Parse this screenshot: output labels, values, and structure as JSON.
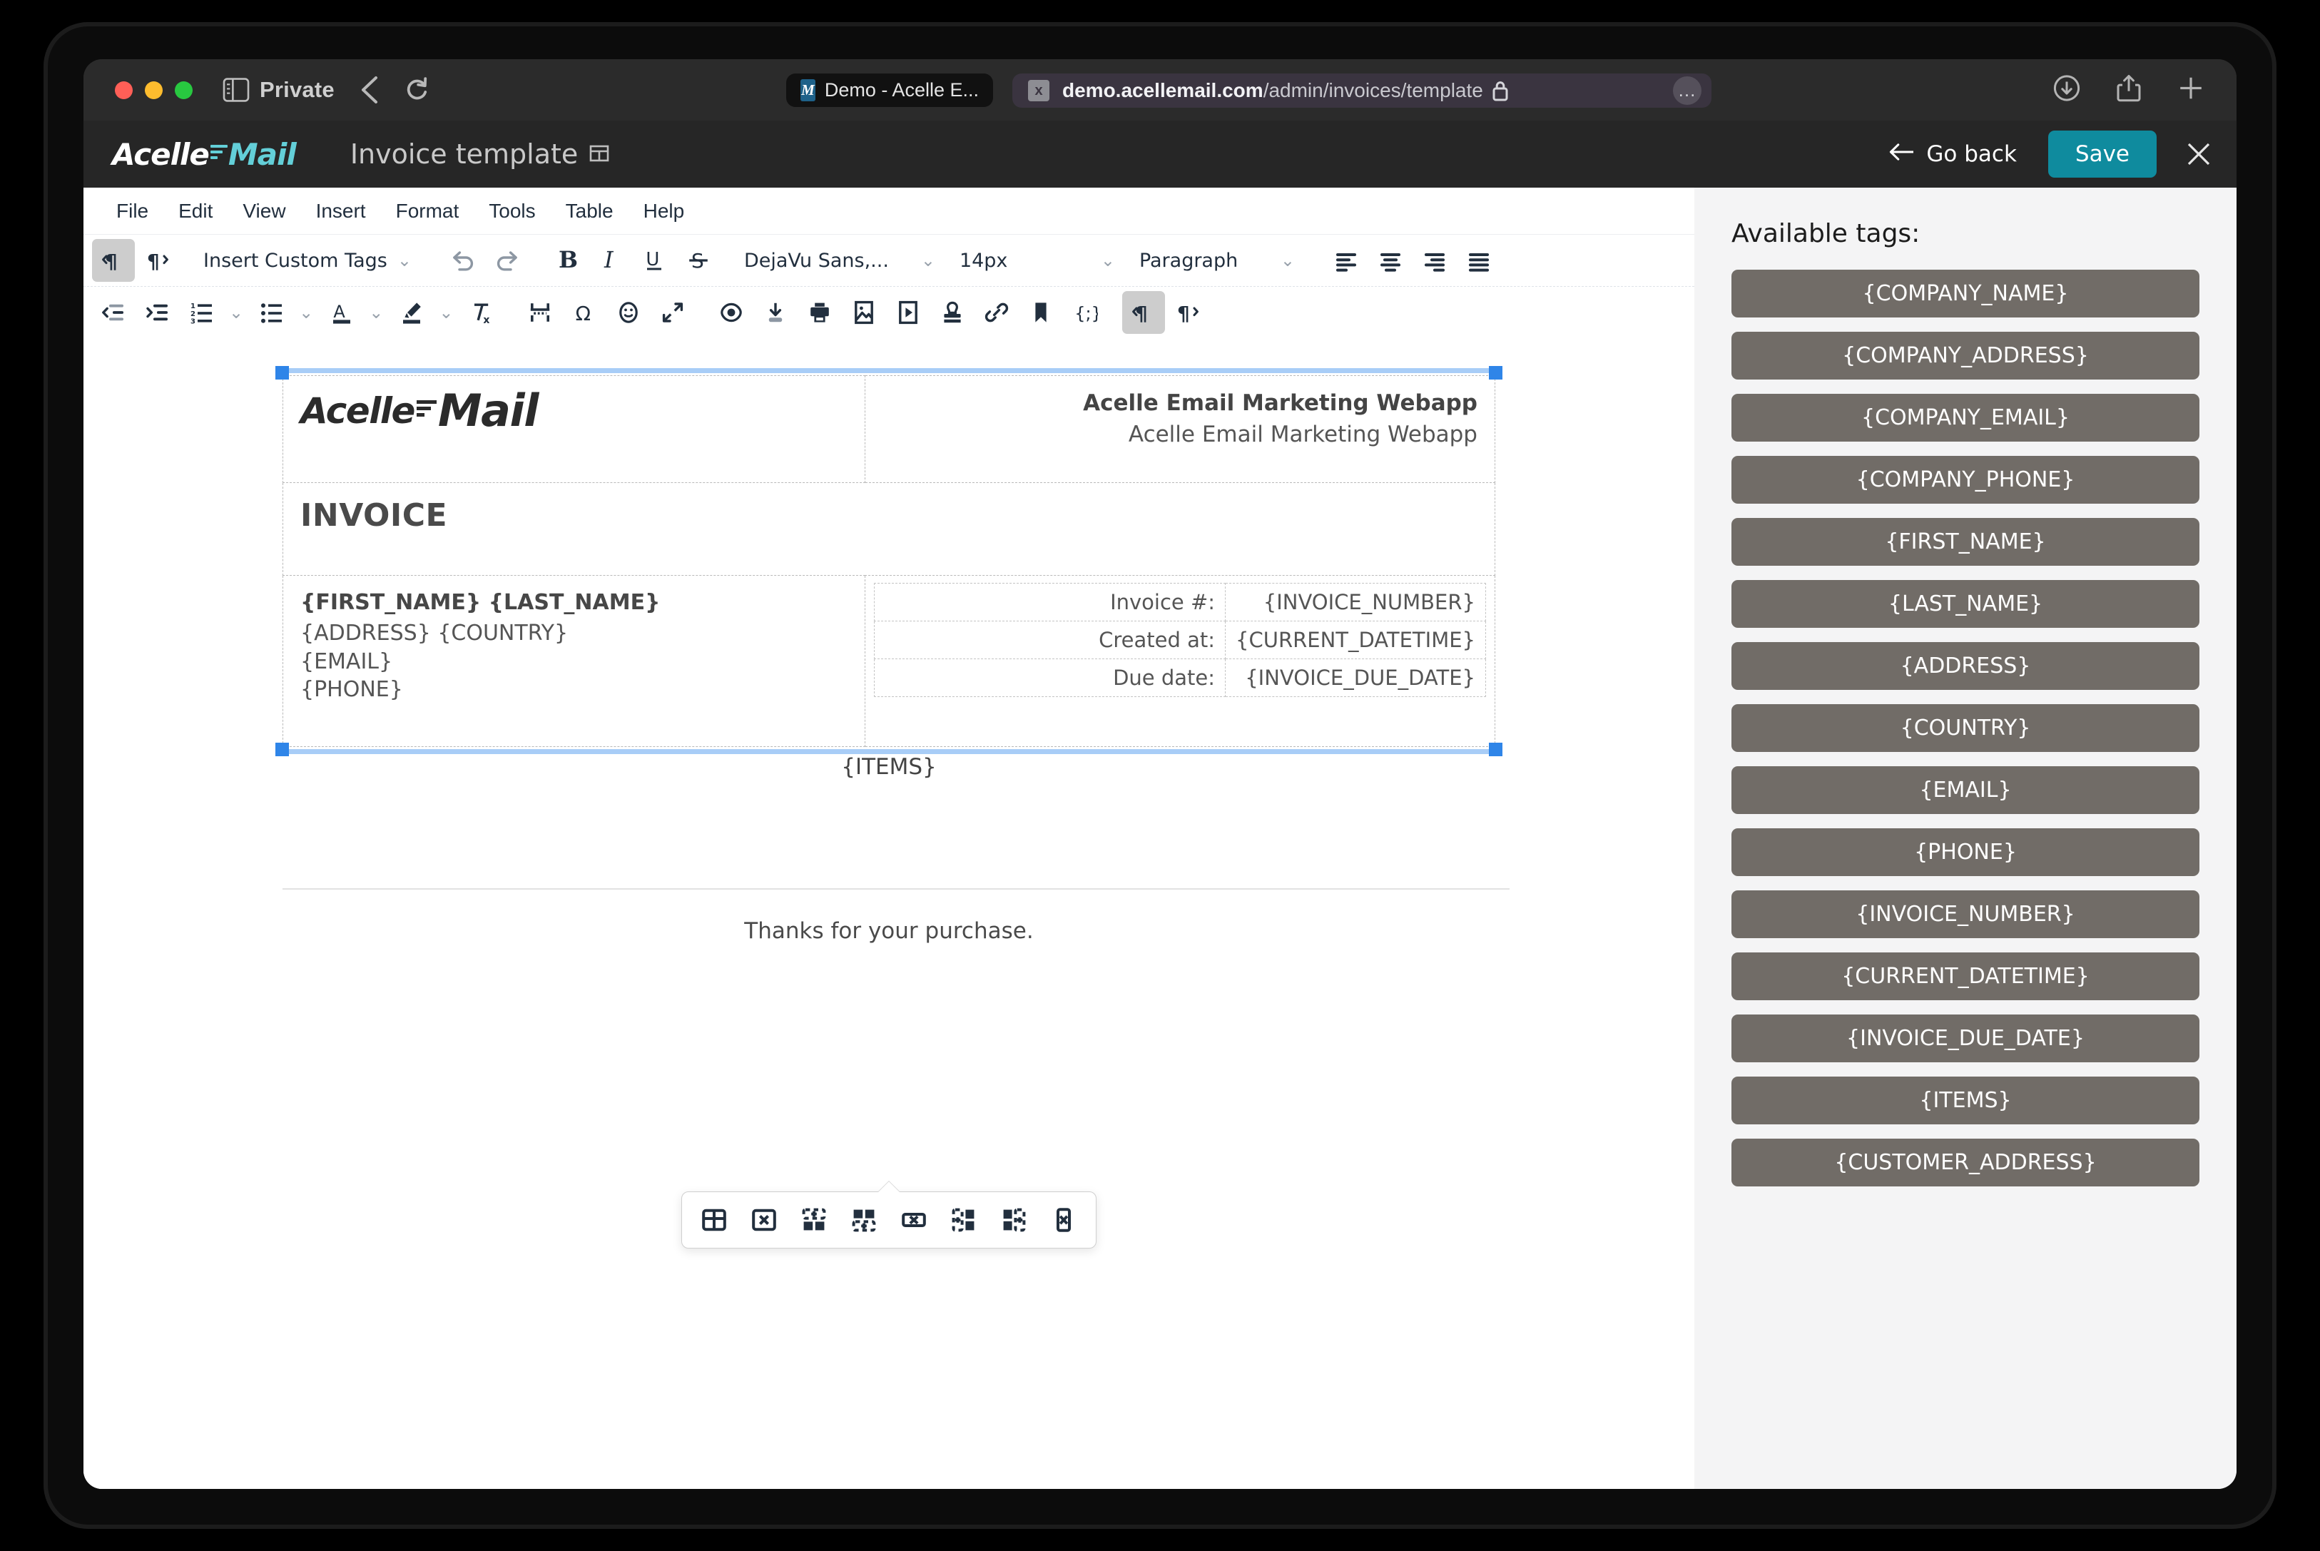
{
  "browser": {
    "private_label": "Private",
    "back_icon": "chevron-left-icon",
    "reload_icon": "reload-icon",
    "tab": {
      "favicon_letter": "M",
      "title": "Demo - Acelle E..."
    },
    "url": {
      "scheme_badge": "x",
      "host": "demo.acellemail.com",
      "path": "/admin/invoices/template",
      "lock_icon": "lock-icon"
    },
    "more_dots": "…",
    "right_icons": [
      "download-icon",
      "share-icon",
      "new-tab-icon"
    ]
  },
  "app": {
    "brand": {
      "text_left": "Acelle",
      "text_right": "Mail",
      "accent": "#63cfd8"
    },
    "title": "Invoice template",
    "title_icon": "page-layout-icon",
    "go_back": "Go back",
    "save": "Save",
    "close_icon": "close-icon",
    "save_color": "#0f8b9e"
  },
  "menubar": [
    "File",
    "Edit",
    "View",
    "Insert",
    "Format",
    "Tools",
    "Table",
    "Help"
  ],
  "toolbar_row1": {
    "ltr_icon": "ltr-paragraph-icon",
    "rtl_icon": "rtl-paragraph-icon",
    "custom_tags_label": "Insert Custom Tags",
    "undo_icon": "undo-icon",
    "redo_icon": "redo-icon",
    "bold": "B",
    "italic": "I",
    "underline": "U",
    "strike": "S",
    "font_family": "DejaVu Sans,...",
    "font_size": "14px",
    "block_format": "Paragraph",
    "align_left_icon": "align-left-icon",
    "align_center_icon": "align-center-icon",
    "align_right_icon": "align-right-icon",
    "align_justify_icon": "align-justify-icon"
  },
  "toolbar_row2": {
    "items": [
      "outdent-icon",
      "indent-icon",
      "numbered-list-icon",
      "bullet-list-icon",
      "text-color-icon",
      "highlight-color-icon",
      "clear-formatting-icon",
      "horizontal-rule-icon",
      "special-character-icon",
      "emoji-icon",
      "fullscreen-icon",
      "preview-icon",
      "save-download-icon",
      "print-icon",
      "insert-image-icon",
      "insert-media-icon",
      "template-stamp-icon",
      "insert-link-icon",
      "anchor-bookmark-icon",
      "source-code-icon",
      "ltr-paragraph-icon",
      "rtl-paragraph-icon"
    ]
  },
  "document": {
    "logo_left": "Acelle",
    "logo_right": "Mail",
    "company_name": "Acelle Email Marketing Webapp",
    "company_sub": "Acelle Email Marketing Webapp",
    "invoice_heading": "INVOICE",
    "bill_to": {
      "name": "{FIRST_NAME} {LAST_NAME}",
      "address": "{ADDRESS} {COUNTRY}",
      "email": "{EMAIL}",
      "phone": "{PHONE}"
    },
    "meta_rows": [
      {
        "label": "Invoice #:",
        "value": "{INVOICE_NUMBER}"
      },
      {
        "label": "Created at:",
        "value": "{CURRENT_DATETIME}"
      },
      {
        "label": "Due date:",
        "value": "{INVOICE_DUE_DATE}"
      }
    ],
    "items_placeholder": "{ITEMS}",
    "footer_text": "Thanks for your purchase."
  },
  "table_toolbar": {
    "buttons": [
      "table-properties-icon",
      "delete-table-icon",
      "insert-row-before-icon",
      "insert-row-after-icon",
      "delete-row-icon",
      "insert-column-before-icon",
      "insert-column-after-icon",
      "delete-column-icon"
    ]
  },
  "tags_panel": {
    "title": "Available tags:",
    "pill_color": "#716c67",
    "tags": [
      "{COMPANY_NAME}",
      "{COMPANY_ADDRESS}",
      "{COMPANY_EMAIL}",
      "{COMPANY_PHONE}",
      "{FIRST_NAME}",
      "{LAST_NAME}",
      "{ADDRESS}",
      "{COUNTRY}",
      "{EMAIL}",
      "{PHONE}",
      "{INVOICE_NUMBER}",
      "{CURRENT_DATETIME}",
      "{INVOICE_DUE_DATE}",
      "{ITEMS}",
      "{CUSTOMER_ADDRESS}"
    ]
  }
}
